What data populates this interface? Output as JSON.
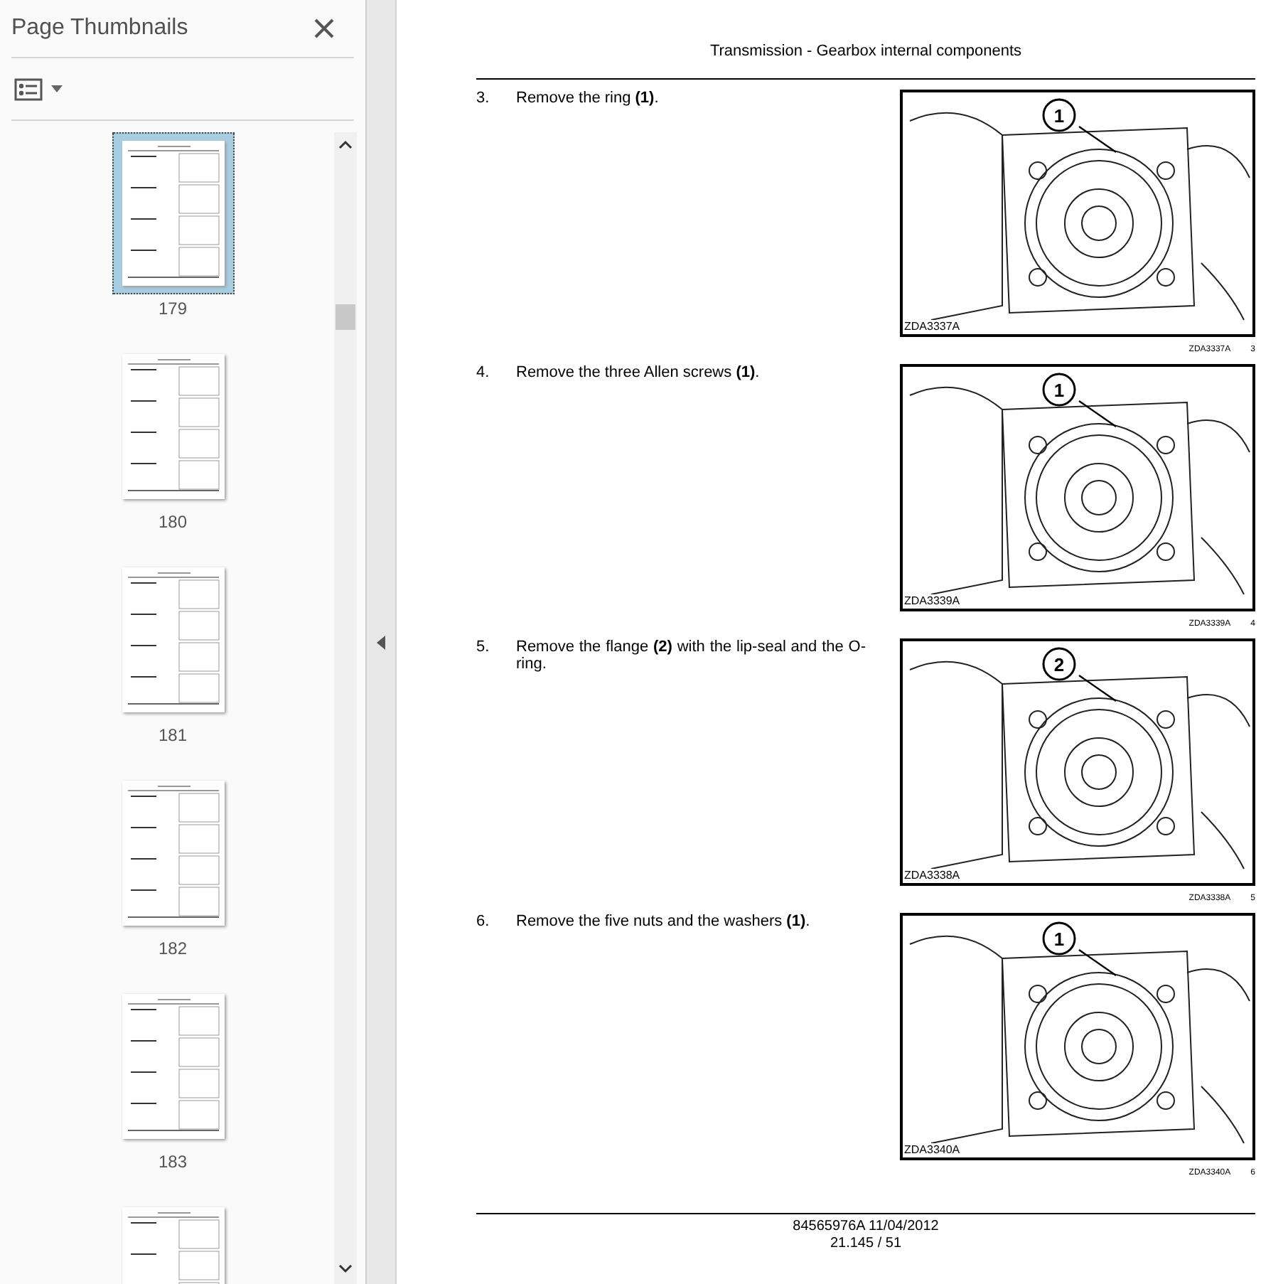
{
  "sidebar": {
    "title": "Page Thumbnails",
    "thumbnails": [
      {
        "page": "179",
        "selected": true
      },
      {
        "page": "180",
        "selected": false
      },
      {
        "page": "181",
        "selected": false
      },
      {
        "page": "182",
        "selected": false
      },
      {
        "page": "183",
        "selected": false
      },
      {
        "selected": false
      }
    ]
  },
  "document": {
    "header": "Transmission - Gearbox internal components",
    "steps": [
      {
        "number": "3.",
        "text": "Remove the ring **(1)**.",
        "callout": "1",
        "image_code": "ZDA3337A",
        "caption_code": "ZDA3337A",
        "caption_number": "3"
      },
      {
        "number": "4.",
        "text": "Remove the three Allen screws **(1)**.",
        "callout": "1",
        "image_code": "ZDA3339A",
        "caption_code": "ZDA3339A",
        "caption_number": "4"
      },
      {
        "number": "5.",
        "text": "Remove the flange **(2)** with the lip-seal and the O-ring.",
        "callout": "2",
        "image_code": "ZDA3338A",
        "caption_code": "ZDA3338A",
        "caption_number": "5"
      },
      {
        "number": "6.",
        "text": "Remove the five nuts and the washers **(1)**.",
        "callout": "1",
        "image_code": "ZDA3340A",
        "caption_code": "ZDA3340A",
        "caption_number": "6"
      }
    ],
    "footer": {
      "doc_id": "84565976A 11/04/2012",
      "page": "21.145 / 51"
    }
  }
}
